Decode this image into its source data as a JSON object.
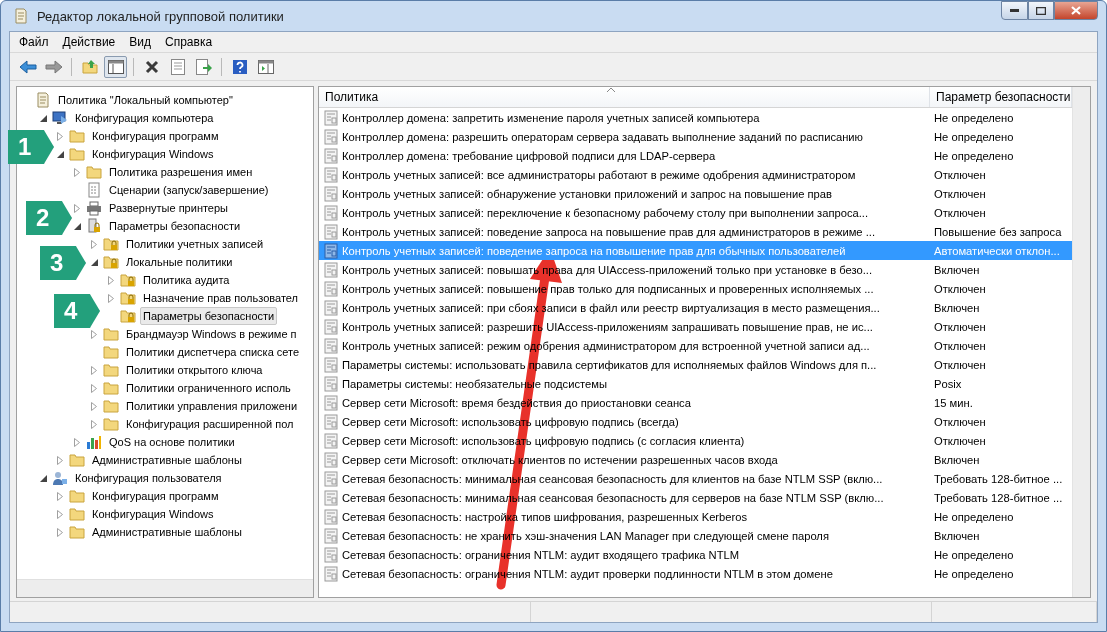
{
  "window": {
    "title": "Редактор локальной групповой политики"
  },
  "menu": [
    "Файл",
    "Действие",
    "Вид",
    "Справка"
  ],
  "tree": [
    {
      "label": "Политика \"Локальный компьютер\"",
      "kind": "doc",
      "selected": false,
      "children": [
        {
          "label": "Конфигурация компьютера",
          "kind": "computer",
          "expanded": true,
          "selected": false,
          "children": [
            {
              "label": "Конфигурация программ",
              "kind": "folder",
              "expanded": false,
              "selected": false
            },
            {
              "label": "Конфигурация Windows",
              "kind": "folder",
              "expanded": true,
              "selected": false,
              "children": [
                {
                  "label": "Политика разрешения имен",
                  "kind": "folder",
                  "expanded": false,
                  "selected": false
                },
                {
                  "label": "Сценарии (запуск/завершение)",
                  "kind": "script",
                  "selected": false
                },
                {
                  "label": "Развернутые принтеры",
                  "kind": "printer",
                  "expanded": false,
                  "selected": false
                },
                {
                  "label": "Параметры безопасности",
                  "kind": "secure",
                  "expanded": true,
                  "selected": false,
                  "children": [
                    {
                      "label": "Политики учетных записей",
                      "kind": "lockfolder",
                      "expanded": false,
                      "selected": false
                    },
                    {
                      "label": "Локальные политики",
                      "kind": "lockfolder",
                      "expanded": true,
                      "selected": false,
                      "children": [
                        {
                          "label": "Политика аудита",
                          "kind": "lockfolder",
                          "expanded": false,
                          "selected": false
                        },
                        {
                          "label": "Назначение прав пользовател",
                          "kind": "lockfolder",
                          "expanded": false,
                          "selected": false
                        },
                        {
                          "label": "Параметры безопасности",
                          "kind": "lockfolder",
                          "selected": true
                        }
                      ]
                    },
                    {
                      "label": "Брандмауэр Windows в режиме п",
                      "kind": "folder",
                      "expanded": false,
                      "selected": false
                    },
                    {
                      "label": "Политики диспетчера списка сете",
                      "kind": "folder",
                      "selected": false
                    },
                    {
                      "label": "Политики открытого ключа",
                      "kind": "folder",
                      "expanded": false,
                      "selected": false
                    },
                    {
                      "label": "Политики ограниченного исполь",
                      "kind": "folder",
                      "expanded": false,
                      "selected": false
                    },
                    {
                      "label": "Политики управления приложени",
                      "kind": "folder",
                      "expanded": false,
                      "selected": false
                    },
                    {
                      "label": "Конфигурация расширенной пол",
                      "kind": "folder",
                      "expanded": false,
                      "selected": false
                    }
                  ]
                },
                {
                  "label": "QoS на основе политики",
                  "kind": "chart",
                  "expanded": false,
                  "selected": false
                }
              ]
            },
            {
              "label": "Административные шаблоны",
              "kind": "folder",
              "expanded": false,
              "selected": false
            }
          ]
        },
        {
          "label": "Конфигурация пользователя",
          "kind": "user",
          "expanded": true,
          "selected": false,
          "children": [
            {
              "label": "Конфигурация программ",
              "kind": "folder",
              "expanded": false,
              "selected": false
            },
            {
              "label": "Конфигурация Windows",
              "kind": "folder",
              "expanded": false,
              "selected": false
            },
            {
              "label": "Административные шаблоны",
              "kind": "folder",
              "expanded": false,
              "selected": false
            }
          ]
        }
      ]
    }
  ],
  "table": {
    "columns": [
      "Политика",
      "Параметр безопасности"
    ],
    "rows": [
      {
        "policy": "Контроллер домена: запретить изменение пароля учетных записей компьютера",
        "setting": "Не определено",
        "selected": false
      },
      {
        "policy": "Контроллер домена: разрешить операторам сервера задавать выполнение заданий по расписанию",
        "setting": "Не определено",
        "selected": false
      },
      {
        "policy": "Контроллер домена: требование цифровой подписи для LDAP-сервера",
        "setting": "Не определено",
        "selected": false
      },
      {
        "policy": "Контроль учетных записей: все администраторы работают в режиме одобрения администратором",
        "setting": "Отключен",
        "selected": false
      },
      {
        "policy": "Контроль учетных записей: обнаружение установки приложений и запрос на повышение прав",
        "setting": "Отключен",
        "selected": false
      },
      {
        "policy": "Контроль учетных записей: переключение к безопасному рабочему столу при выполнении запроса...",
        "setting": "Отключен",
        "selected": false
      },
      {
        "policy": "Контроль учетных записей: поведение запроса на повышение прав для администраторов в режиме ...",
        "setting": "Повышение без запроса",
        "selected": false
      },
      {
        "policy": "Контроль учетных записей: поведение запроса на повышение прав для обычных пользователей",
        "setting": "Автоматически отклон...",
        "selected": true
      },
      {
        "policy": "Контроль учетных записей: повышать права для UIAccess-приложений только при установке в безо...",
        "setting": "Включен",
        "selected": false
      },
      {
        "policy": "Контроль учетных записей: повышение прав только для подписанных и проверенных исполняемых ...",
        "setting": "Отключен",
        "selected": false
      },
      {
        "policy": "Контроль учетных записей: при сбоях записи в файл или реестр виртуализация в место размещения...",
        "setting": "Включен",
        "selected": false
      },
      {
        "policy": "Контроль учетных записей: разрешить UIAccess-приложениям запрашивать повышение прав, не ис...",
        "setting": "Отключен",
        "selected": false
      },
      {
        "policy": "Контроль учетных записей: режим одобрения администратором для встроенной учетной записи ад...",
        "setting": "Отключен",
        "selected": false
      },
      {
        "policy": "Параметры системы: использовать правила сертификатов для исполняемых файлов Windows для п...",
        "setting": "Отключен",
        "selected": false
      },
      {
        "policy": "Параметры системы: необязательные подсистемы",
        "setting": "Posix",
        "selected": false
      },
      {
        "policy": "Сервер сети Microsoft: время бездействия до приостановки сеанса",
        "setting": "15 мин.",
        "selected": false
      },
      {
        "policy": "Сервер сети Microsoft: использовать цифровую подпись (всегда)",
        "setting": "Отключен",
        "selected": false
      },
      {
        "policy": "Сервер сети Microsoft: использовать цифровую подпись (с согласия клиента)",
        "setting": "Отключен",
        "selected": false
      },
      {
        "policy": "Сервер сети Microsoft: отключать клиентов по истечении разрешенных часов входа",
        "setting": "Включен",
        "selected": false
      },
      {
        "policy": "Сетевая безопасность: минимальная сеансовая безопасность для клиентов на базе NTLM SSP (вклю...",
        "setting": "Требовать 128-битное ...",
        "selected": false
      },
      {
        "policy": "Сетевая безопасность: минимальная сеансовая безопасность для серверов на базе NTLM SSP (вклю...",
        "setting": "Требовать 128-битное ...",
        "selected": false
      },
      {
        "policy": "Сетевая безопасность: настройка типов шифрования, разрешенных Kerberos",
        "setting": "Не определено",
        "selected": false
      },
      {
        "policy": "Сетевая безопасность: не хранить хэш-значения LAN Manager при следующей смене пароля",
        "setting": "Включен",
        "selected": false
      },
      {
        "policy": "Сетевая безопасность: ограничения NTLM: аудит входящего трафика NTLM",
        "setting": "Не определено",
        "selected": false
      },
      {
        "policy": "Сетевая безопасность: ограничения NTLM: аудит проверки подлинности NTLM в этом домене",
        "setting": "Не определено",
        "selected": false
      }
    ]
  },
  "callouts": [
    "1",
    "2",
    "3",
    "4"
  ]
}
